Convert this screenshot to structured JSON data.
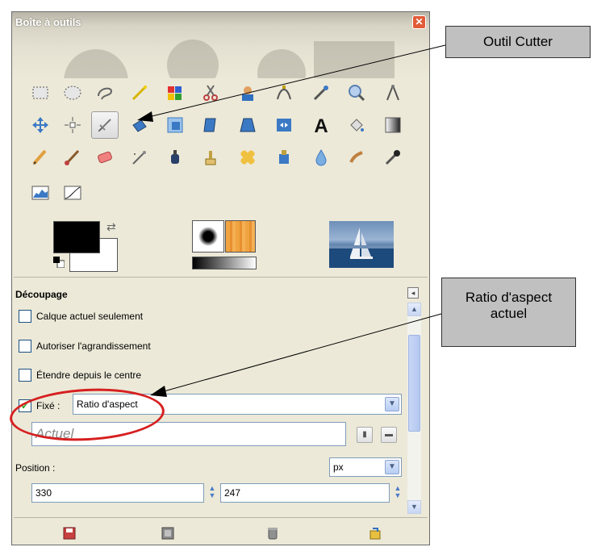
{
  "window": {
    "title": "Boîte à outils",
    "close_label": "✕"
  },
  "tools": [
    {
      "name": "rect-select-tool-icon",
      "active": false
    },
    {
      "name": "ellipse-select-tool-icon",
      "active": false
    },
    {
      "name": "free-select-tool-icon",
      "active": false
    },
    {
      "name": "fuzzy-select-tool-icon",
      "active": false
    },
    {
      "name": "select-by-color-tool-icon",
      "active": false
    },
    {
      "name": "scissors-tool-icon",
      "active": false
    },
    {
      "name": "foreground-select-tool-icon",
      "active": false
    },
    {
      "name": "paths-tool-icon",
      "active": false
    },
    {
      "name": "color-picker-tool-icon",
      "active": false
    },
    {
      "name": "zoom-tool-icon",
      "active": false
    },
    {
      "name": "measure-tool-icon",
      "active": false
    },
    {
      "name": "move-tool-icon",
      "active": false
    },
    {
      "name": "align-tool-icon",
      "active": false
    },
    {
      "name": "crop-tool-icon",
      "active": true
    },
    {
      "name": "rotate-tool-icon",
      "active": false
    },
    {
      "name": "scale-tool-icon",
      "active": false
    },
    {
      "name": "shear-tool-icon",
      "active": false
    },
    {
      "name": "perspective-tool-icon",
      "active": false
    },
    {
      "name": "flip-tool-icon",
      "active": false
    },
    {
      "name": "text-tool-icon",
      "active": false
    },
    {
      "name": "bucket-fill-tool-icon",
      "active": false
    },
    {
      "name": "blend-tool-icon",
      "active": false
    },
    {
      "name": "pencil-tool-icon",
      "active": false
    },
    {
      "name": "paintbrush-tool-icon",
      "active": false
    },
    {
      "name": "eraser-tool-icon",
      "active": false
    },
    {
      "name": "airbrush-tool-icon",
      "active": false
    },
    {
      "name": "ink-tool-icon",
      "active": false
    },
    {
      "name": "clone-tool-icon",
      "active": false
    },
    {
      "name": "heal-tool-icon",
      "active": false
    },
    {
      "name": "perspective-clone-tool-icon",
      "active": false
    },
    {
      "name": "blur-tool-icon",
      "active": false
    },
    {
      "name": "smudge-tool-icon",
      "active": false
    },
    {
      "name": "dodge-burn-tool-icon",
      "active": false
    },
    {
      "name": "levels-tool-icon",
      "active": false
    },
    {
      "name": "curves-tool-icon",
      "active": false
    }
  ],
  "options": {
    "title": "Découpage",
    "current_layer_only": "Calque actuel seulement",
    "allow_growing": "Autoriser l'agrandissement",
    "expand_from_center": "Étendre depuis le centre",
    "fixed_label": "Fixé :",
    "fixed_checked": true,
    "fixed_value": "Ratio d'aspect",
    "aspect_placeholder": "Actuel",
    "position_label": "Position :",
    "unit": "px",
    "pos_x": "330",
    "pos_y": "247"
  },
  "callouts": {
    "cutter": "Outil Cutter",
    "ratio_line1": "Ratio d'aspect",
    "ratio_line2": "actuel"
  },
  "colors": {
    "foreground": "#000000",
    "background": "#ffffff",
    "highlight_ring": "#d61f1f"
  }
}
